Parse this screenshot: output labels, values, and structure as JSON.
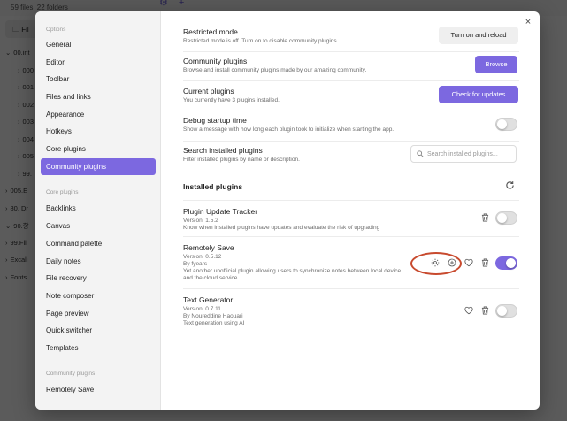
{
  "background": {
    "file_count": "59 files, 22 folders",
    "files_button": "Fil",
    "tree": [
      {
        "label": "00.int",
        "indent": false,
        "arrow": "⌄"
      },
      {
        "label": "000",
        "indent": true,
        "arrow": "›"
      },
      {
        "label": "001",
        "indent": true,
        "arrow": "›"
      },
      {
        "label": "002",
        "indent": true,
        "arrow": "›"
      },
      {
        "label": "003",
        "indent": true,
        "arrow": "›"
      },
      {
        "label": "004",
        "indent": true,
        "arrow": "›"
      },
      {
        "label": "005",
        "indent": true,
        "arrow": "›"
      },
      {
        "label": "99.",
        "indent": true,
        "arrow": "›"
      },
      {
        "label": "005.E",
        "indent": false,
        "arrow": "›"
      },
      {
        "label": "80. Dr",
        "indent": false,
        "arrow": "›"
      },
      {
        "label": "90.항",
        "indent": false,
        "arrow": "⌄"
      },
      {
        "label": "99.Fil",
        "indent": false,
        "arrow": "›"
      },
      {
        "label": "Excali",
        "indent": false,
        "arrow": "›"
      },
      {
        "label": "Fonts",
        "indent": false,
        "arrow": "›"
      }
    ]
  },
  "modal": {
    "close": "×",
    "sidebar": {
      "options_header": "Options",
      "options": [
        "General",
        "Editor",
        "Toolbar",
        "Files and links",
        "Appearance",
        "Hotkeys",
        "Core plugins",
        "Community plugins"
      ],
      "core_header": "Core plugins",
      "core": [
        "Backlinks",
        "Canvas",
        "Command palette",
        "Daily notes",
        "File recovery",
        "Note composer",
        "Page preview",
        "Quick switcher",
        "Templates"
      ],
      "community_header": "Community plugins",
      "community": [
        "Remotely Save"
      ]
    },
    "settings": {
      "restricted": {
        "title": "Restricted mode",
        "desc": "Restricted mode is off. Turn on to disable community plugins.",
        "button": "Turn on and reload"
      },
      "community": {
        "title": "Community plugins",
        "desc": "Browse and install community plugins made by our amazing community.",
        "button": "Browse"
      },
      "current": {
        "title": "Current plugins",
        "desc": "You currently have 3 plugins installed.",
        "button": "Check for updates"
      },
      "debug": {
        "title": "Debug startup time",
        "desc": "Show a message with how long each plugin took to initialize when starting the app."
      },
      "search": {
        "title": "Search installed plugins",
        "desc": "Filter installed plugins by name or description.",
        "placeholder": "Search installed plugins..."
      }
    },
    "installed_title": "Installed plugins",
    "plugins": [
      {
        "name": "Plugin Update Tracker",
        "version": "Version: 1.5.2",
        "author": "",
        "desc": "Know when installed plugins have updates and evaluate the risk of upgrading"
      },
      {
        "name": "Remotely Save",
        "version": "Version: 0.5.12",
        "author": "By fyears",
        "desc1": "Yet another unofficial plugin allowing users to synchronize notes between local device",
        "desc2": "and the cloud service."
      },
      {
        "name": "Text Generator",
        "version": "Version: 0.7.11",
        "author": "By Noureddine Haouari",
        "desc": "Text generation using AI"
      }
    ]
  },
  "colors": {
    "accent": "#7c68e0",
    "highlight": "#c84a2e"
  }
}
